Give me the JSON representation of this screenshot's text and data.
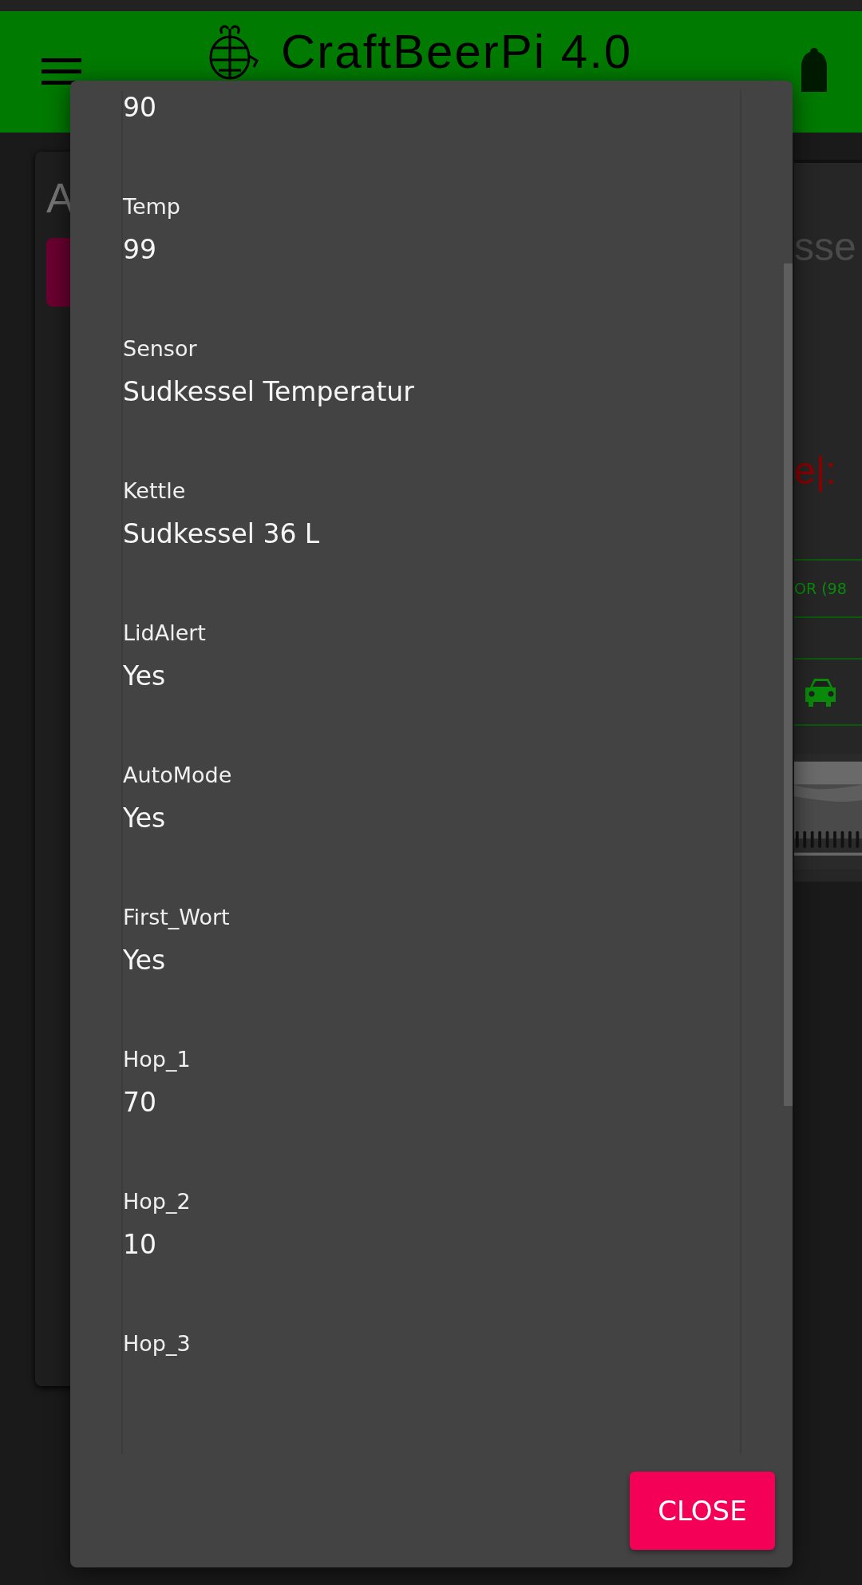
{
  "header": {
    "title": "CraftBeerPi 4.0"
  },
  "background": {
    "left_card": {
      "title": "A"
    },
    "right_card": {
      "title": "sse",
      "status": "e|:",
      "sensor": "OR (98"
    }
  },
  "dialog": {
    "fields": [
      {
        "value": "90"
      },
      {
        "label": "Temp",
        "value": "99"
      },
      {
        "label": "Sensor",
        "value": "Sudkessel Temperatur"
      },
      {
        "label": "Kettle",
        "value": "Sudkessel 36 L"
      },
      {
        "label": "LidAlert",
        "value": "Yes"
      },
      {
        "label": "AutoMode",
        "value": "Yes"
      },
      {
        "label": "First_Wort",
        "value": "Yes"
      },
      {
        "label": "Hop_1",
        "value": "70"
      },
      {
        "label": "Hop_2",
        "value": "10"
      },
      {
        "label": "Hop_3"
      }
    ],
    "close_button": "CLOSE"
  }
}
